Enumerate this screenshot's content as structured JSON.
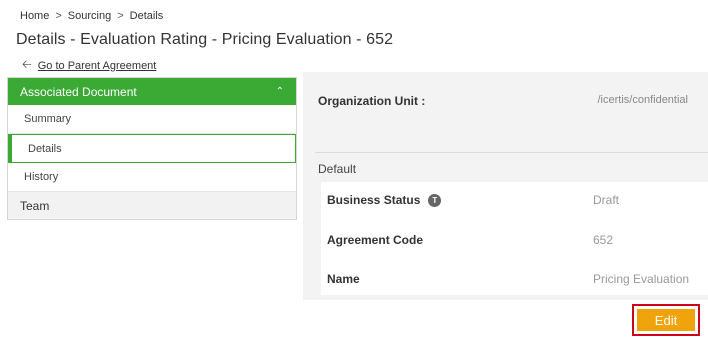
{
  "breadcrumb": {
    "items": [
      "Home",
      "Sourcing",
      "Details"
    ],
    "separator": ">"
  },
  "page": {
    "title": "Details - Evaluation Rating - Pricing Evaluation - 652",
    "back_link": "Go to Parent Agreement"
  },
  "sidebar": {
    "header": "Associated Document",
    "items": [
      {
        "label": "Summary"
      },
      {
        "label": "Details"
      },
      {
        "label": "History"
      }
    ],
    "active_item": "Details",
    "team": "Team",
    "accent_color": "#3aaa35"
  },
  "main": {
    "org_label": "Organization Unit :",
    "org_value": "/icertis/confidential",
    "section": "Default",
    "fields": [
      {
        "label": "Business Status",
        "badge": "T",
        "value": "Draft"
      },
      {
        "label": "Agreement Code",
        "value": "652"
      },
      {
        "label": "Name",
        "value": "Pricing Evaluation"
      }
    ]
  },
  "actions": {
    "edit": "Edit",
    "edit_color": "#f0a30a",
    "highlight_color": "#d0021b"
  }
}
